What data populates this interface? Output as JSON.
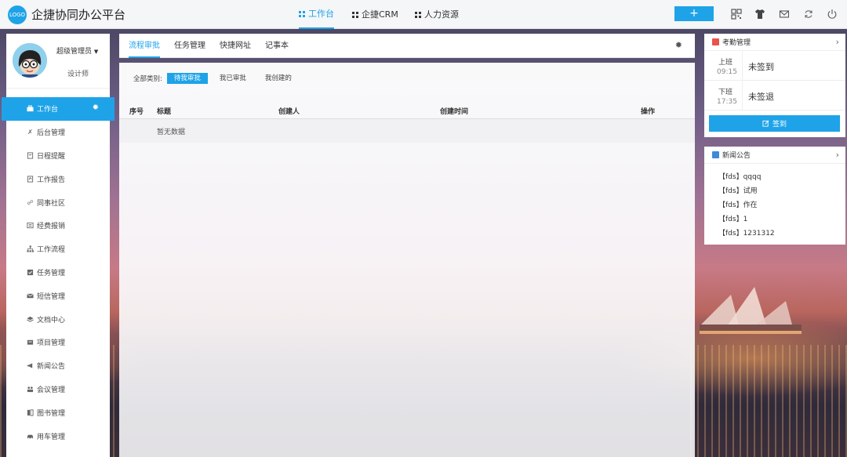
{
  "header": {
    "logo_text": "LOGO",
    "app_title": "企捷协同办公平台",
    "nav": [
      {
        "label": "工作台"
      },
      {
        "label": "企捷CRM"
      },
      {
        "label": "人力资源"
      }
    ],
    "add_label": "+"
  },
  "profile": {
    "username": "超级管理员",
    "role": "设计师"
  },
  "sidebar": {
    "items": [
      {
        "label": "工作台",
        "icon": "briefcase-icon"
      },
      {
        "label": "后台管理",
        "icon": "tools-icon"
      },
      {
        "label": "日程提醒",
        "icon": "calendar-icon"
      },
      {
        "label": "工作报告",
        "icon": "report-icon"
      },
      {
        "label": "同事社区",
        "icon": "community-icon"
      },
      {
        "label": "经费报销",
        "icon": "expense-icon"
      },
      {
        "label": "工作流程",
        "icon": "flow-icon"
      },
      {
        "label": "任务管理",
        "icon": "task-icon"
      },
      {
        "label": "短信管理",
        "icon": "mail-icon"
      },
      {
        "label": "文档中心",
        "icon": "layers-icon"
      },
      {
        "label": "项目管理",
        "icon": "project-icon"
      },
      {
        "label": "新闻公告",
        "icon": "megaphone-icon"
      },
      {
        "label": "会议管理",
        "icon": "meeting-icon"
      },
      {
        "label": "图书管理",
        "icon": "book-icon"
      },
      {
        "label": "用车管理",
        "icon": "car-icon"
      }
    ]
  },
  "main": {
    "tabs": [
      {
        "label": "流程审批"
      },
      {
        "label": "任务管理"
      },
      {
        "label": "快捷网址"
      },
      {
        "label": "记事本"
      }
    ],
    "filter": {
      "label": "全部类别:",
      "options": [
        {
          "label": "待我审批"
        },
        {
          "label": "我已审批"
        },
        {
          "label": "我创建的"
        }
      ]
    },
    "table": {
      "columns": [
        "序号",
        "标题",
        "创建人",
        "创建时间",
        "操作"
      ],
      "empty_text": "暂无数据"
    }
  },
  "attendance": {
    "title": "考勤管理",
    "rows": [
      {
        "label": "上班",
        "time": "09:15",
        "status": "未签到"
      },
      {
        "label": "下班",
        "time": "17:35",
        "status": "未签退"
      }
    ],
    "button": "签到"
  },
  "news": {
    "title": "新闻公告",
    "items": [
      "【fds】qqqq",
      "【fds】试用",
      "【fds】作在",
      "【fds】1",
      "【fds】1231312"
    ]
  },
  "colors": {
    "accent": "#1ea3e8",
    "attendance_icon": "#e8554e",
    "news_icon": "#3c8ad8"
  }
}
